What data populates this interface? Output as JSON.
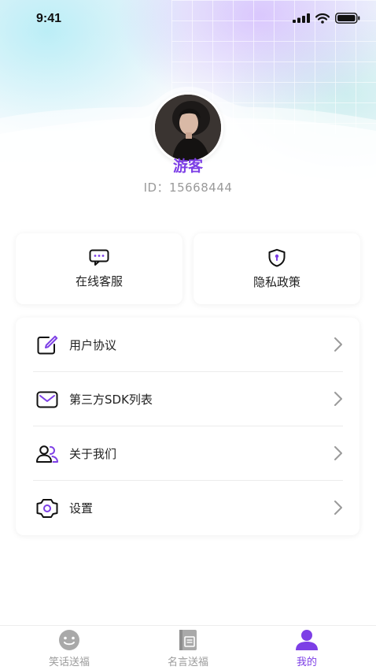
{
  "status_bar": {
    "time": "9:41"
  },
  "profile": {
    "nickname": "游客",
    "user_id": "ID：15668444"
  },
  "quick_cards": [
    {
      "label": "在线客服",
      "icon": "chat-bubble-icon"
    },
    {
      "label": "隐私政策",
      "icon": "shield-lock-icon"
    }
  ],
  "menu": [
    {
      "label": "用户协议",
      "icon": "edit-icon"
    },
    {
      "label": "第三方SDK列表",
      "icon": "mail-icon"
    },
    {
      "label": "关于我们",
      "icon": "users-icon"
    },
    {
      "label": "设置",
      "icon": "settings-icon"
    }
  ],
  "tabbar": {
    "items": [
      {
        "label": "笑话送福",
        "icon": "smiley-icon",
        "active": false
      },
      {
        "label": "名言送福",
        "icon": "book-icon",
        "active": false
      },
      {
        "label": "我的",
        "icon": "user-icon",
        "active": true
      }
    ]
  },
  "colors": {
    "accent": "#7d3fe6",
    "inactive": "#9b9b9b"
  }
}
